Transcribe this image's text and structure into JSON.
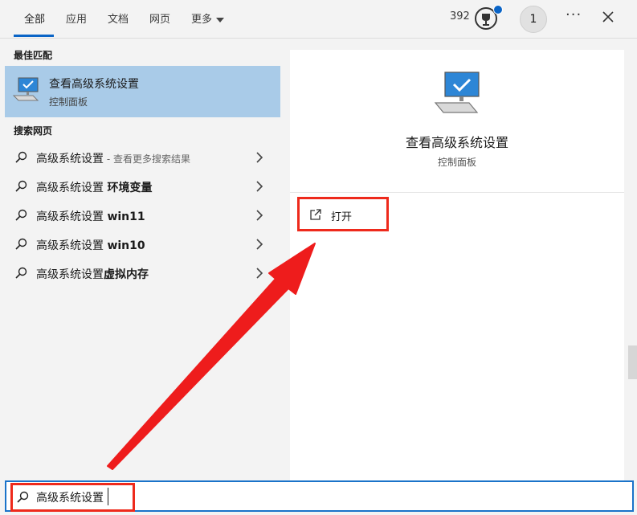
{
  "tabs": [
    {
      "label": "全部",
      "active": true
    },
    {
      "label": "应用",
      "active": false
    },
    {
      "label": "文档",
      "active": false
    },
    {
      "label": "网页",
      "active": false
    },
    {
      "label": "更多",
      "active": false
    }
  ],
  "header": {
    "points": "392",
    "avatar_initial": "1",
    "more_label": "···"
  },
  "left": {
    "best_match_title": "最佳匹配",
    "best_match": {
      "title": "查看高级系统设置",
      "subtitle": "控制面板",
      "icon": "monitor-check-icon"
    },
    "web_title": "搜索网页",
    "web_results": [
      {
        "main": "高级系统设置",
        "hint": " - 查看更多搜索结果",
        "bold": ""
      },
      {
        "main": "高级系统设置 ",
        "hint": "",
        "bold": "环境变量"
      },
      {
        "main": "高级系统设置 ",
        "hint": "",
        "bold": "win11"
      },
      {
        "main": "高级系统设置 ",
        "hint": "",
        "bold": "win10"
      },
      {
        "main": "高级系统设置",
        "hint": "",
        "bold": "虚拟内存"
      }
    ]
  },
  "preview": {
    "title": "查看高级系统设置",
    "subtitle": "控制面板",
    "actions": [
      {
        "label": "打开",
        "icon": "open-external-icon"
      }
    ]
  },
  "search": {
    "value": "高级系统设置"
  },
  "colors": {
    "accent": "#0a64c6",
    "highlight": "#a9cbe8",
    "annotation_red": "#ee2a1c"
  }
}
